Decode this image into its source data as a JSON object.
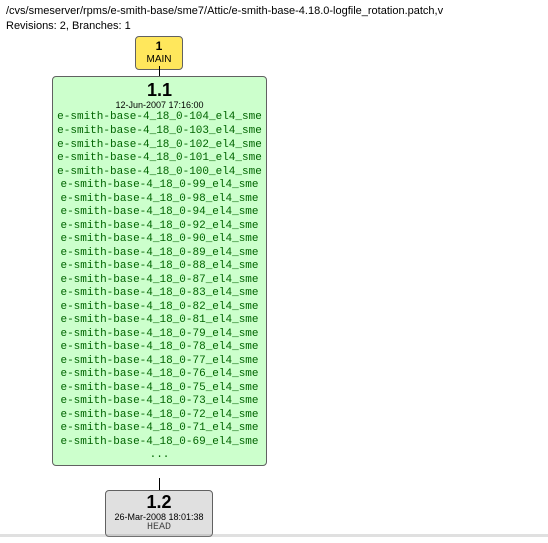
{
  "header": {
    "path": "/cvs/smeserver/rpms/e-smith-base/sme7/Attic/e-smith-base-4.18.0-logfile_rotation.patch,v",
    "revisions_line": "Revisions: 2, Branches: 1"
  },
  "branch": {
    "num": "1",
    "name": "MAIN"
  },
  "rev11": {
    "num": "1.1",
    "date": "12-Jun-2007 17:16:00",
    "tags": [
      "e-smith-base-4_18_0-104_el4_sme",
      "e-smith-base-4_18_0-103_el4_sme",
      "e-smith-base-4_18_0-102_el4_sme",
      "e-smith-base-4_18_0-101_el4_sme",
      "e-smith-base-4_18_0-100_el4_sme",
      "e-smith-base-4_18_0-99_el4_sme",
      "e-smith-base-4_18_0-98_el4_sme",
      "e-smith-base-4_18_0-94_el4_sme",
      "e-smith-base-4_18_0-92_el4_sme",
      "e-smith-base-4_18_0-90_el4_sme",
      "e-smith-base-4_18_0-89_el4_sme",
      "e-smith-base-4_18_0-88_el4_sme",
      "e-smith-base-4_18_0-87_el4_sme",
      "e-smith-base-4_18_0-83_el4_sme",
      "e-smith-base-4_18_0-82_el4_sme",
      "e-smith-base-4_18_0-81_el4_sme",
      "e-smith-base-4_18_0-79_el4_sme",
      "e-smith-base-4_18_0-78_el4_sme",
      "e-smith-base-4_18_0-77_el4_sme",
      "e-smith-base-4_18_0-76_el4_sme",
      "e-smith-base-4_18_0-75_el4_sme",
      "e-smith-base-4_18_0-73_el4_sme",
      "e-smith-base-4_18_0-72_el4_sme",
      "e-smith-base-4_18_0-71_el4_sme",
      "e-smith-base-4_18_0-69_el4_sme"
    ],
    "ellipsis": "..."
  },
  "rev12": {
    "num": "1.2",
    "date": "26-Mar-2008 18:01:38",
    "tags": [
      "HEAD"
    ]
  }
}
